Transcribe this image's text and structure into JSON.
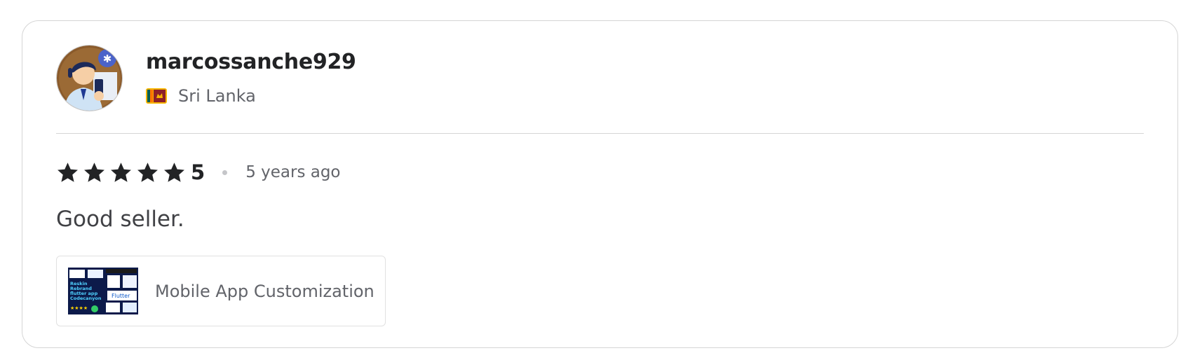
{
  "review": {
    "username": "marcossanche929",
    "country": "Sri Lanka",
    "country_flag_icon": "flag-sri-lanka-icon",
    "rating": 5,
    "rating_label": "5",
    "rating_max": 5,
    "time_ago": "5 years ago",
    "text": "Good seller.",
    "gig": {
      "title": "Mobile App Customization",
      "thumb_lines": [
        "Reskin",
        "Rebrand",
        "flutter app",
        "Codecanyon",
        "Flutter"
      ]
    }
  },
  "colors": {
    "star": "#222325",
    "text_primary": "#222325",
    "text_secondary": "#62646a",
    "border": "#d5d5d5",
    "avatar_bg": "#8a5a2b",
    "thumb_bg": "#0c1a4a"
  }
}
